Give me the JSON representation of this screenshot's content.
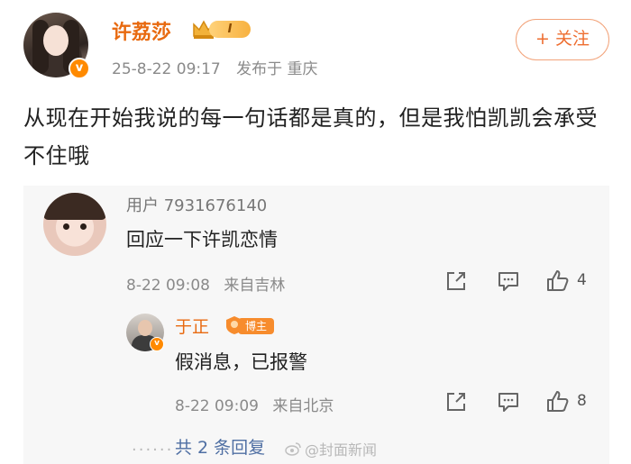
{
  "post": {
    "author": "许荔莎",
    "level_badge": "I",
    "date": "25-8-22 09:17",
    "location": "发布于 重庆",
    "follow_label": "+ 关注",
    "content": "从现在开始我说的每一句话都是真的，但是我怕凯凯会承受不住哦"
  },
  "comment": {
    "user": "用户 7931676140",
    "text": "回应一下许凯恋情",
    "time": "8-22 09:08",
    "source": "来自吉林",
    "likes": "4"
  },
  "reply": {
    "user": "于正",
    "badge": "博主",
    "text": "假消息，已报警",
    "time": "8-22 09:09",
    "source": "来自北京",
    "likes": "8"
  },
  "more_replies": "共 2 条回复",
  "watermark": "@封面新闻",
  "icons": [
    "verified-v-icon",
    "crown-icon",
    "repost-icon",
    "comment-icon",
    "like-icon"
  ],
  "colors": {
    "accent": "#e86a10",
    "link": "#4f6fa3",
    "meta": "#8a8a8a",
    "comment_bg": "#f7f7f7"
  }
}
